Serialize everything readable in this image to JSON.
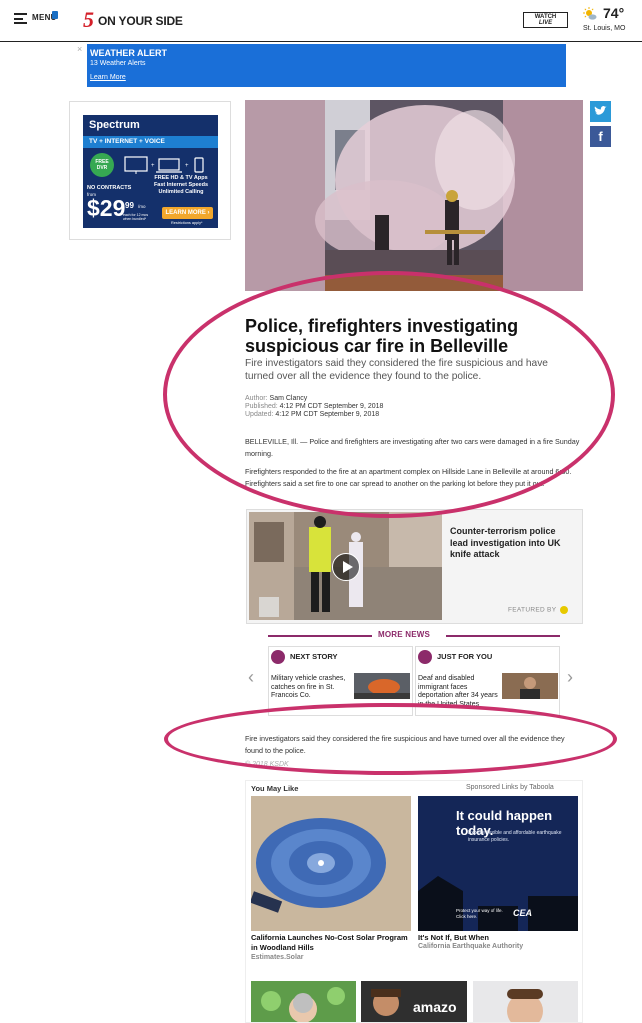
{
  "header": {
    "menu_label": "MENU",
    "logo_number": "5",
    "logo_text": "ON YOUR SIDE",
    "watch_live_1": "WATCH",
    "watch_live_2": "LIVE",
    "temperature": "74°",
    "location": "St. Louis, MO",
    "weather_icon": "partly-sunny-icon"
  },
  "weather_alert": {
    "title": "WEATHER ALERT",
    "subtitle": "13 Weather Alerts",
    "link": "Learn More",
    "close": "×"
  },
  "ad": {
    "brand": "Spectrum",
    "tagline": "TV + INTERNET + VOICE",
    "dvr_badge": "FREE DVR",
    "features": "FREE HD & TV Apps Fast Internet Speeds Unlimited Calling",
    "no_contracts": "NO CONTRACTS",
    "from": "from",
    "price_dollar": "$29",
    "price_cents": "99",
    "per_month": "/mo",
    "fine_print": "each for 12 mos when bundled*",
    "learn_more": "LEARN MORE ›",
    "restrictions": "Restrictions apply*"
  },
  "article": {
    "headline": "Police, firefighters investigating suspicious car fire in Belleville",
    "dek": "Fire investigators said they considered the fire suspicious and have turned over all the evidence they found to the police.",
    "author_label": "Author:",
    "author": "Sam Clancy",
    "published_label": "Published:",
    "published": "4:12 PM CDT September 9, 2018",
    "updated_label": "Updated:",
    "updated": "4:12 PM CDT September 9, 2018",
    "paragraph_1": "BELLEVILLE, Ill. — Police and firefighters are investigating after two cars were damaged in a fire Sunday morning.",
    "paragraph_2": "Firefighters responded to the fire at an apartment complex on Hillside Lane in Belleville at around 6:30. Firefighters said a set fire to one car spread to another on the parking lot before they put it out.",
    "summary": "Fire investigators said they considered the fire suspicious and have turned over all the evidence they found to the police.",
    "copyright": "© 2018 KSDK"
  },
  "video": {
    "title": "Counter-terrorism police lead investigation into UK knife attack",
    "featured_by": "FEATURED BY"
  },
  "more_news": {
    "label": "MORE NEWS",
    "next_story_label": "NEXT STORY",
    "next_story_title": "Military vehicle crashes, catches on fire in St. Francois Co.",
    "just_for_you_label": "JUST FOR YOU",
    "just_for_you_title": "Deaf and disabled immigrant faces deportation after 34 years in the United States",
    "prev_arrow": "‹",
    "next_arrow": "›"
  },
  "taboola": {
    "heading": "You May Like",
    "sponsored": "Sponsored Links by Taboola",
    "items": [
      {
        "title": "California Launches No-Cost Solar Program in Woodland Hills",
        "source": "Estimates.Solar"
      },
      {
        "title": "It's Not If, But When",
        "source": "California Earthquake Authority",
        "ad_headline": "It could happen today.",
        "ad_copy": "Explore flexible and affordable earthquake insurance policies.",
        "ad_cta": "Protect your way of life. Click here.",
        "ad_logo": "CEA"
      }
    ],
    "row2_brand": "amazo"
  },
  "colors": {
    "accent": "#8c2a6a",
    "alert_blue": "#1a6fd8",
    "logo_red": "#d4202a",
    "annotation": "#c9316b"
  }
}
